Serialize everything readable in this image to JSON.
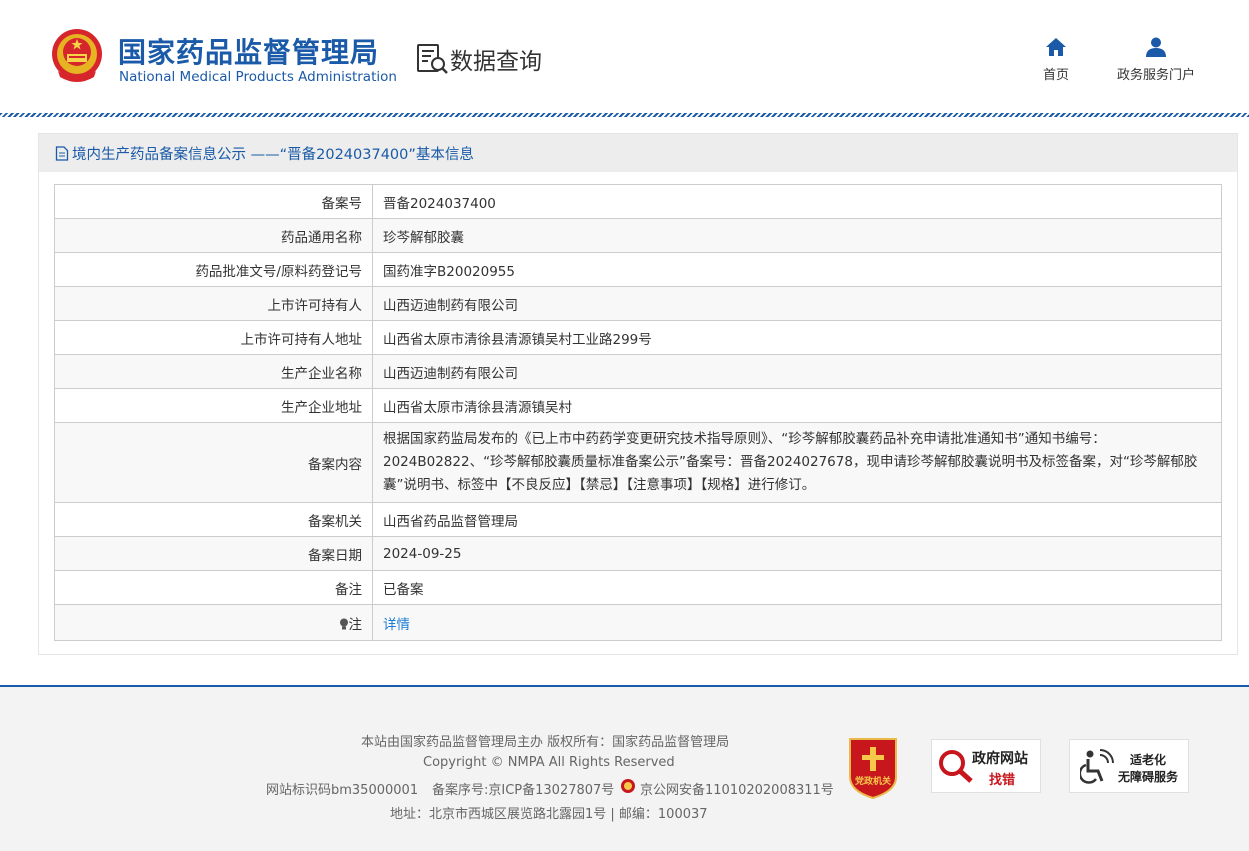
{
  "header": {
    "agency_cn": "国家药品监督管理局",
    "agency_en": "National Medical Products Administration",
    "section_title": "数据查询",
    "nav": [
      {
        "label": "首页",
        "icon": "home-icon"
      },
      {
        "label": "政务服务门户",
        "icon": "user-icon"
      }
    ]
  },
  "panel": {
    "title": "境内生产药品备案信息公示 ——“晋备2024037400”基本信息",
    "rows": [
      {
        "label": "备案号",
        "value": "晋备2024037400"
      },
      {
        "label": "药品通用名称",
        "value": "珍芩解郁胶囊"
      },
      {
        "label": "药品批准文号/原料药登记号",
        "value": "国药准字B20020955"
      },
      {
        "label": "上市许可持有人",
        "value": "山西迈迪制药有限公司"
      },
      {
        "label": "上市许可持有人地址",
        "value": "山西省太原市清徐县清源镇吴村工业路299号"
      },
      {
        "label": "生产企业名称",
        "value": "山西迈迪制药有限公司"
      },
      {
        "label": "生产企业地址",
        "value": "山西省太原市清徐县清源镇吴村"
      },
      {
        "label": "备案内容",
        "value": "根据国家药监局发布的《已上市中药药学变更研究技术指导原则》、“珍芩解郁胶囊药品补充申请批准通知书”通知书编号：2024B02822、“珍芩解郁胶囊质量标准备案公示”备案号：晋备2024027678，现申请珍芩解郁胶囊说明书及标签备案，对“珍芩解郁胶囊”说明书、标签中【不良反应】【禁忌】【注意事项】【规格】进行修订。"
      },
      {
        "label": "备案机关",
        "value": "山西省药品监督管理局"
      },
      {
        "label": "备案日期",
        "value": "2024-09-25"
      },
      {
        "label": "备注",
        "value": "已备案"
      }
    ],
    "note_label": "注",
    "note_link": "详情"
  },
  "footer": {
    "line1": "本站由国家药品监督管理局主办 版权所有：国家药品监督管理局",
    "line2": "Copyright © NMPA All Rights Reserved",
    "site_id": "网站标识码bm35000001",
    "icp": "备案序号:京ICP备13027807号",
    "police": "京公网安备11010202008311号",
    "address": "地址：北京市西城区展览路北露园1号 | 邮编：100037",
    "party_badge_text": "党政机关",
    "gov_badge_line1": "政府网站",
    "gov_badge_line2": "找错",
    "age_badge_line1": "适老化",
    "age_badge_line2": "无障碍服务"
  },
  "colors": {
    "brand_blue": "#1a5aa8",
    "link_blue": "#1a7bd5",
    "party_red": "#c8161d"
  }
}
